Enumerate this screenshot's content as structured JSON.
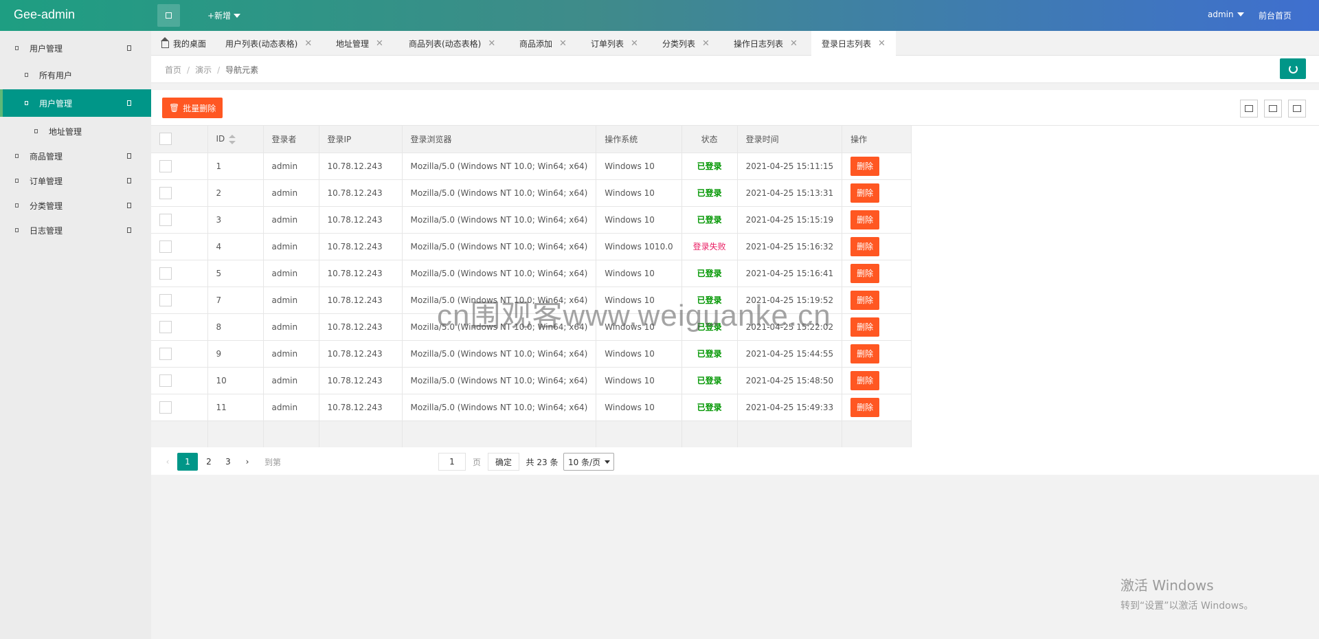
{
  "header": {
    "logo": "Gee-admin",
    "add_new": "+新增",
    "user": "admin",
    "front_link": "前台首页"
  },
  "sidebar": {
    "items": [
      {
        "label": "用户管理",
        "level": 0
      },
      {
        "label": "所有用户",
        "level": 1
      },
      {
        "label": "用户管理",
        "level": 1,
        "active": true
      },
      {
        "label": "地址管理",
        "level": 2
      },
      {
        "label": "商品管理",
        "level": 0
      },
      {
        "label": "订单管理",
        "level": 0
      },
      {
        "label": "分类管理",
        "level": 0
      },
      {
        "label": "日志管理",
        "level": 0
      }
    ]
  },
  "tabs": [
    {
      "label": "我的桌面",
      "closable": false
    },
    {
      "label": "用户列表(动态表格)",
      "closable": true
    },
    {
      "label": "地址管理",
      "closable": true
    },
    {
      "label": "商品列表(动态表格)",
      "closable": true
    },
    {
      "label": "商品添加",
      "closable": true
    },
    {
      "label": "订单列表",
      "closable": true
    },
    {
      "label": "分类列表",
      "closable": true
    },
    {
      "label": "操作日志列表",
      "closable": true
    },
    {
      "label": "登录日志列表",
      "closable": true,
      "active": true
    }
  ],
  "tab_close_glyph": "✕",
  "breadcrumb": {
    "items": [
      "首页",
      "演示",
      "导航元素"
    ],
    "separator": "/"
  },
  "toolbar": {
    "batch_delete": "批量删除"
  },
  "table": {
    "columns": [
      "ID",
      "登录者",
      "登录IP",
      "登录浏览器",
      "操作系统",
      "状态",
      "登录时间",
      "操作"
    ],
    "rows": [
      {
        "id": "1",
        "user": "admin",
        "ip": "10.78.12.243",
        "browser": "Mozilla/5.0 (Windows NT 10.0; Win64; x64)",
        "os": "Windows 10",
        "status": "已登录",
        "ok": true,
        "time": "2021-04-25 15:11:15",
        "action": "删除"
      },
      {
        "id": "2",
        "user": "admin",
        "ip": "10.78.12.243",
        "browser": "Mozilla/5.0 (Windows NT 10.0; Win64; x64)",
        "os": "Windows 10",
        "status": "已登录",
        "ok": true,
        "time": "2021-04-25 15:13:31",
        "action": "删除"
      },
      {
        "id": "3",
        "user": "admin",
        "ip": "10.78.12.243",
        "browser": "Mozilla/5.0 (Windows NT 10.0; Win64; x64)",
        "os": "Windows 10",
        "status": "已登录",
        "ok": true,
        "time": "2021-04-25 15:15:19",
        "action": "删除"
      },
      {
        "id": "4",
        "user": "admin",
        "ip": "10.78.12.243",
        "browser": "Mozilla/5.0 (Windows NT 10.0; Win64; x64)",
        "os": "Windows 1010.0",
        "status": "登录失败",
        "ok": false,
        "time": "2021-04-25 15:16:32",
        "action": "删除"
      },
      {
        "id": "5",
        "user": "admin",
        "ip": "10.78.12.243",
        "browser": "Mozilla/5.0 (Windows NT 10.0; Win64; x64)",
        "os": "Windows 10",
        "status": "已登录",
        "ok": true,
        "time": "2021-04-25 15:16:41",
        "action": "删除"
      },
      {
        "id": "7",
        "user": "admin",
        "ip": "10.78.12.243",
        "browser": "Mozilla/5.0 (Windows NT 10.0; Win64; x64)",
        "os": "Windows 10",
        "status": "已登录",
        "ok": true,
        "time": "2021-04-25 15:19:52",
        "action": "删除"
      },
      {
        "id": "8",
        "user": "admin",
        "ip": "10.78.12.243",
        "browser": "Mozilla/5.0 (Windows NT 10.0; Win64; x64)",
        "os": "Windows 10",
        "status": "已登录",
        "ok": true,
        "time": "2021-04-25 15:22:02",
        "action": "删除"
      },
      {
        "id": "9",
        "user": "admin",
        "ip": "10.78.12.243",
        "browser": "Mozilla/5.0 (Windows NT 10.0; Win64; x64)",
        "os": "Windows 10",
        "status": "已登录",
        "ok": true,
        "time": "2021-04-25 15:44:55",
        "action": "删除"
      },
      {
        "id": "10",
        "user": "admin",
        "ip": "10.78.12.243",
        "browser": "Mozilla/5.0 (Windows NT 10.0; Win64; x64)",
        "os": "Windows 10",
        "status": "已登录",
        "ok": true,
        "time": "2021-04-25 15:48:50",
        "action": "删除"
      },
      {
        "id": "11",
        "user": "admin",
        "ip": "10.78.12.243",
        "browser": "Mozilla/5.0 (Windows NT 10.0; Win64; x64)",
        "os": "Windows 10",
        "status": "已登录",
        "ok": true,
        "time": "2021-04-25 15:49:33",
        "action": "删除"
      }
    ]
  },
  "pager": {
    "prev": "‹",
    "pages": [
      "1",
      "2",
      "3"
    ],
    "current": "1",
    "next": "›",
    "goto_label": "到第",
    "goto_value": "1",
    "page_unit": "页",
    "confirm": "确定",
    "total": "共 23 条",
    "page_size": "10 条/页"
  },
  "overlays": {
    "watermark": "cn围观客www.weiguanke.cn",
    "activate_title": "激活 Windows",
    "activate_sub": "转到“设置”以激活 Windows。"
  },
  "colors": {
    "accent": "#009688",
    "danger": "#ff5722",
    "success_text": "#009600",
    "fail_text": "#e91e63"
  }
}
